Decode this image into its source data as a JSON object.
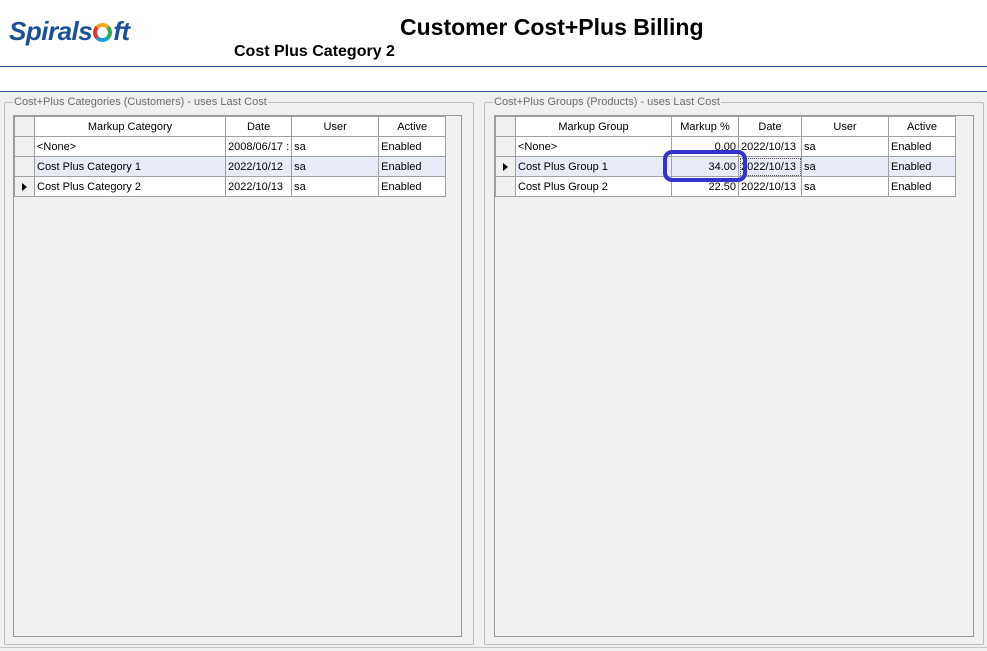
{
  "header": {
    "logo_text_a": "Spirals",
    "logo_text_b": "ft",
    "title": "Customer Cost+Plus Billing",
    "subtitle": "Cost Plus Category 2"
  },
  "categories_panel": {
    "legend": "Cost+Plus Categories (Customers)  -  uses Last Cost",
    "columns": [
      "Markup Category",
      "Date",
      "User",
      "Active"
    ],
    "rows": [
      {
        "name": "<None>",
        "date": "2008/06/17 :",
        "user": "sa",
        "active": "Enabled"
      },
      {
        "name": "Cost Plus Category 1",
        "date": "2022/10/12",
        "user": "sa",
        "active": "Enabled"
      },
      {
        "name": "Cost Plus Category 2",
        "date": "2022/10/13",
        "user": "sa",
        "active": "Enabled"
      }
    ],
    "current_row_index": 2
  },
  "groups_panel": {
    "legend": "Cost+Plus Groups (Products)  -  uses Last Cost",
    "columns": [
      "Markup Group",
      "Markup %",
      "Date",
      "User",
      "Active"
    ],
    "rows": [
      {
        "name": "<None>",
        "markup": "0.00",
        "date": "2022/10/13",
        "user": "sa",
        "active": "Enabled"
      },
      {
        "name": "Cost Plus Group 1",
        "markup": "34.00",
        "date": "2022/10/13",
        "user": "sa",
        "active": "Enabled"
      },
      {
        "name": "Cost Plus Group 2",
        "markup": "22.50",
        "date": "2022/10/13",
        "user": "sa",
        "active": "Enabled"
      }
    ],
    "current_row_index": 1
  },
  "colors": {
    "brand_blue": "#1b4f9c",
    "header_rule": "#2a4fa0",
    "highlight_ring": "#3333cc",
    "selected_row": "#e8ecf8"
  }
}
